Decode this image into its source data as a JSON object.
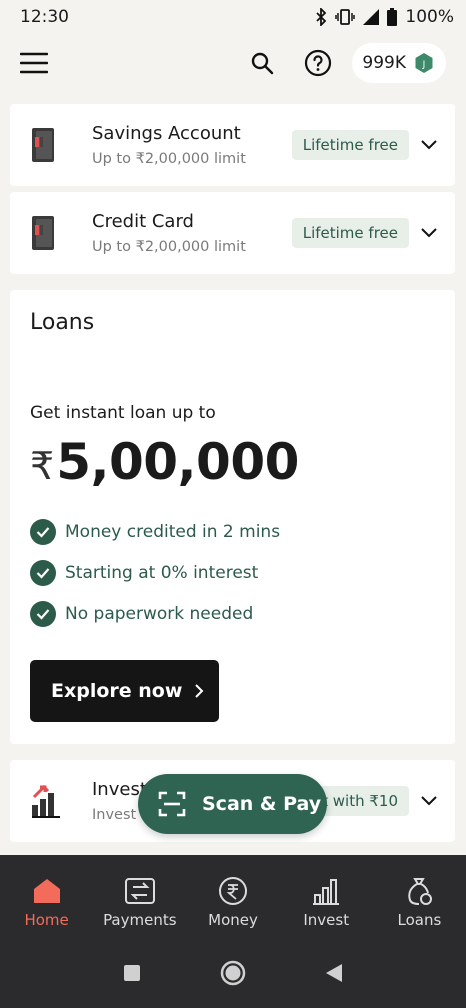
{
  "status": {
    "time": "12:30",
    "battery": "100%"
  },
  "header": {
    "points": "999K",
    "points_badge": "J"
  },
  "products": [
    {
      "title": "Savings Account",
      "subtitle": "Up to ₹2,00,000 limit",
      "badge": "Lifetime free"
    },
    {
      "title": "Credit Card",
      "subtitle": "Up to ₹2,00,000 limit",
      "badge": "Lifetime free"
    }
  ],
  "loans": {
    "heading": "Loans",
    "intro": "Get instant loan up to",
    "currency": "₹",
    "amount": "5,00,000",
    "features": [
      "Money credited in 2 mins",
      "Starting at 0% interest",
      "No paperwork needed"
    ],
    "cta": "Explore now"
  },
  "invest": {
    "title": "Investr",
    "subtitle": "Invest a",
    "badge": "rt with ₹10"
  },
  "scan_pay": {
    "label": "Scan & Pay"
  },
  "nav": [
    {
      "label": "Home",
      "icon": "home-icon",
      "active": true
    },
    {
      "label": "Payments",
      "icon": "payments-icon",
      "active": false
    },
    {
      "label": "Money",
      "icon": "rupee-icon",
      "active": false
    },
    {
      "label": "Invest",
      "icon": "chart-bars-icon",
      "active": false
    },
    {
      "label": "Loans",
      "icon": "money-bag-icon",
      "active": false
    }
  ],
  "colors": {
    "accent_green": "#2c5b4a",
    "active_nav": "#f26b5b",
    "nav_bg": "#2b2b2d"
  }
}
